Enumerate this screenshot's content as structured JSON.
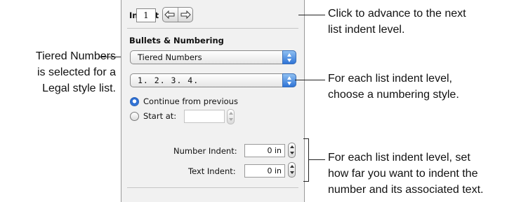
{
  "panel": {
    "indent_level_label": "Indent Level",
    "indent_level_value": "1",
    "bullets_numbering_heading": "Bullets & Numbering",
    "bullet_type_value": "Tiered Numbers",
    "number_format_value": "1. 2. 3. 4.",
    "continue_label": "Continue from previous",
    "start_at_label": "Start at:",
    "start_at_value": "",
    "number_indent_label": "Number Indent:",
    "number_indent_value": "0 in",
    "text_indent_label": "Text Indent:",
    "text_indent_value": "0 in"
  },
  "callouts": {
    "left": [
      "Tiered Numbers",
      "is selected for a",
      "Legal style list."
    ],
    "arrows": [
      "Click to advance to the next",
      "list indent level."
    ],
    "numbering": [
      "For each list indent level,",
      "choose a numbering style."
    ],
    "indent": [
      "For each list indent level, set",
      "how far you want to indent the",
      "number and its associated text."
    ]
  }
}
